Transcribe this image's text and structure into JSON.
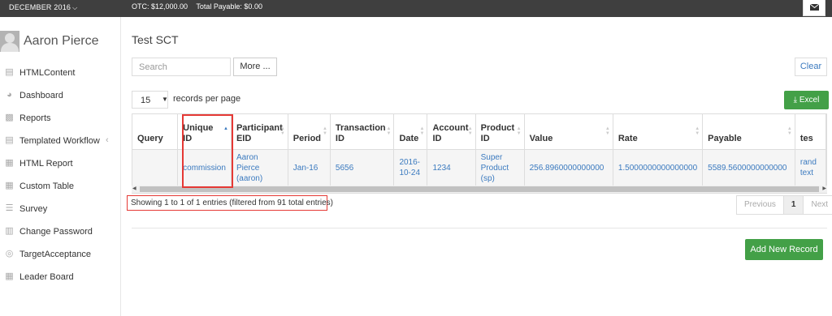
{
  "topbar": {
    "period": "DECEMBER 2016",
    "otc": "OTC: $12,000.00",
    "total_payable": "Total Payable: $0.00"
  },
  "sidebar": {
    "user_name": "Aaron Pierce",
    "items": [
      {
        "label": "HTMLContent",
        "icon": "document-icon"
      },
      {
        "label": "Dashboard",
        "icon": "dashboard-icon"
      },
      {
        "label": "Reports",
        "icon": "bar-chart-icon"
      },
      {
        "label": "Templated Workflow",
        "icon": "document-icon"
      },
      {
        "label": "HTML Report",
        "icon": "grid-icon"
      },
      {
        "label": "Custom Table",
        "icon": "grid-icon"
      },
      {
        "label": "Survey",
        "icon": "list-icon"
      },
      {
        "label": "Change Password",
        "icon": "lock-icon"
      },
      {
        "label": "TargetAcceptance",
        "icon": "target-icon"
      },
      {
        "label": "Leader Board",
        "icon": "grid-icon"
      }
    ]
  },
  "main": {
    "title": "Test SCT",
    "search_placeholder": "Search",
    "more_label": "More ...",
    "clear_label": "Clear",
    "page_size": "15",
    "records_per_page": "records per page",
    "excel_label": "Excel",
    "info": "Showing 1 to 1 of 1 entries (filtered from 91 total entries)",
    "pager": {
      "previous": "Previous",
      "current": "1",
      "next": "Next"
    },
    "add_label": "Add New Record"
  },
  "table": {
    "columns": [
      {
        "l1": "Query",
        "l2": ""
      },
      {
        "l1": "Unique",
        "l2": "ID"
      },
      {
        "l1": "Participant",
        "l2": "EID"
      },
      {
        "l1": "Period",
        "l2": ""
      },
      {
        "l1": "Transaction",
        "l2": "ID"
      },
      {
        "l1": "Date",
        "l2": ""
      },
      {
        "l1": "Account",
        "l2": "ID"
      },
      {
        "l1": "Product",
        "l2": "ID"
      },
      {
        "l1": "Value",
        "l2": ""
      },
      {
        "l1": "Rate",
        "l2": ""
      },
      {
        "l1": "Payable",
        "l2": ""
      },
      {
        "l1": "tes",
        "l2": ""
      }
    ],
    "row": {
      "query": "",
      "unique_id": "commission",
      "participant_l1": "Aaron Pierce",
      "participant_l2": "(aaron)",
      "period": "Jan-16",
      "transaction_id": "5656",
      "date_l1": "2016-",
      "date_l2": "10-24",
      "account_id": "1234",
      "product_l1": "Super",
      "product_l2": "Product",
      "product_l3": "(sp)",
      "value": "256.8960000000000",
      "rate": "1.5000000000000000",
      "payable": "5589.5600000000000",
      "extra_l1": "rand",
      "extra_l2": "text"
    }
  }
}
